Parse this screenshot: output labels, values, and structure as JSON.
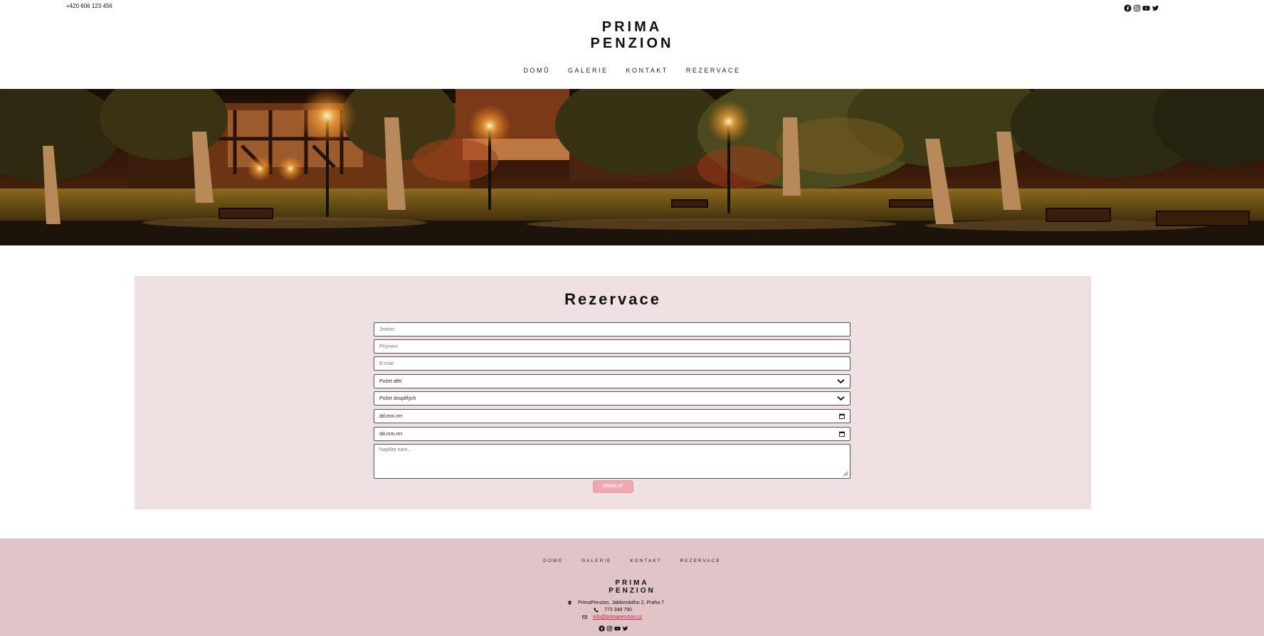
{
  "header": {
    "phone": "+420 606 123 456",
    "logo_line1": "PRIMA",
    "logo_line2": "PENZION",
    "nav": [
      "DOMŮ",
      "GALERIE",
      "KONTAKT",
      "REZERVACE"
    ],
    "social_icons": [
      "facebook-icon",
      "instagram-icon",
      "youtube-icon",
      "twitter-icon"
    ]
  },
  "reservation": {
    "title": "Rezervace",
    "first_name_placeholder": "Jméno",
    "last_name_placeholder": "Příjmení",
    "email_placeholder": "E-mail",
    "children_select": "Počet dětí",
    "adults_select": "Počet dospělých",
    "arrival_date": "dd.mm.rrrr",
    "departure_date": "dd.mm.rrrr",
    "message_placeholder": "Napište nám...",
    "submit_label": "ODESLAT",
    "submit_color": "#f0a7b0"
  },
  "footer": {
    "nav": [
      "DOMŮ",
      "GALERIE",
      "KONTAKT",
      "REZERVACE"
    ],
    "logo_line1": "PRIMA",
    "logo_line2": "PENZION",
    "address": "PrimaPenzion, Jablonského 2, Praha 7",
    "phone": "773 348 790",
    "email": "info@primapenzion.cz",
    "background": "#e1c4c7"
  }
}
